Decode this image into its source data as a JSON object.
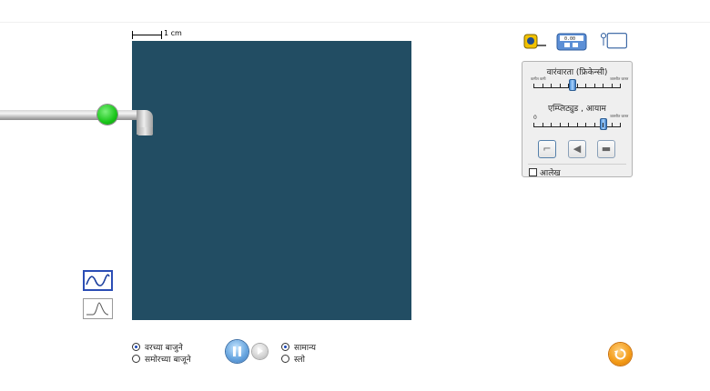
{
  "scale": {
    "label": "1 cm"
  },
  "faucet": {
    "valve_color": "#22cc22"
  },
  "views": {
    "top_view": "wave-icon",
    "side_view": "graph-icon"
  },
  "control_panel": {
    "frequency": {
      "title": "वारंवारता (फ्रिकेन्सी)",
      "min_label": "कमीत कमी",
      "max_label": "जास्तीत जास्त",
      "value": 0.45
    },
    "amplitude": {
      "title": "एम्प्लिट्युड , आयाम",
      "zero_label": "0",
      "max_label": "जास्तीत जास्त",
      "value": 0.8
    },
    "source_buttons": [
      "faucet-icon",
      "speaker-icon",
      "laser-icon"
    ],
    "graph_checkbox": {
      "label": "आलेख",
      "checked": false
    }
  },
  "view_mode": {
    "options": [
      "वरच्या बाजुने",
      "समोरच्या बाजूने"
    ],
    "selected": 0
  },
  "speed": {
    "options": [
      "सामान्य",
      "स्लो"
    ],
    "selected": 0
  },
  "colors": {
    "water": "#224d63",
    "accent": "#2b4db5",
    "reset": "#f39a16"
  }
}
